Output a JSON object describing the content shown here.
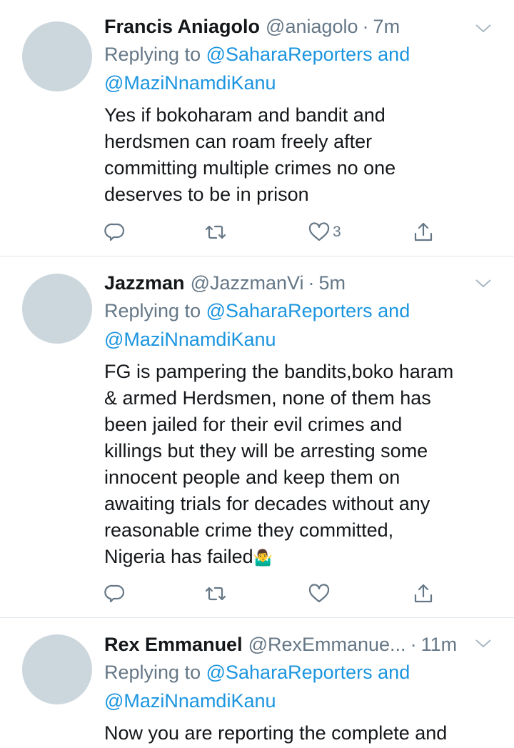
{
  "reply_prefix": "Replying to",
  "tweets": [
    {
      "name": "Francis Aniagolo",
      "handle": "@aniagolo",
      "time": "7m",
      "mention1": "@SaharaReporters",
      "conj": "and",
      "mention2": "@MaziNnamdiKanu",
      "lines": [
        "Yes if bokoharam and bandit and",
        "herdsmen can roam freely after",
        "committing multiple crimes no one",
        "deserves to be in prison"
      ],
      "like_count": "3"
    },
    {
      "name": "Jazzman",
      "handle": "@JazzmanVi",
      "time": "5m",
      "mention1": "@SaharaReporters",
      "conj": "and",
      "mention2": "@MaziNnamdiKanu",
      "lines": [
        "FG is pampering the bandits,boko haram",
        "& armed Herdsmen, none of them has",
        "been jailed for their evil crimes and",
        "killings but they will be arresting some",
        "innocent people and keep them on",
        "awaiting trials for decades without any",
        "reasonable crime they committed,",
        "Nigeria has failed"
      ],
      "emoji": "🤷‍♂️",
      "like_count": ""
    },
    {
      "name": "Rex Emmanuel",
      "handle": "@RexEmmanue...",
      "time": "11m",
      "mention1": "@SaharaReporters",
      "conj": "and",
      "mention2": "@MaziNnamdiKanu",
      "lines": [
        "Now you are reporting the complete and"
      ]
    }
  ],
  "icons": {
    "reply": "reply-icon",
    "retweet": "retweet-icon",
    "like": "heart-icon",
    "share": "share-icon",
    "menu": "chevron-down-icon"
  },
  "colors": {
    "link": "#1b95e0",
    "muted": "#657786",
    "text": "#14171a",
    "avatar": "#ccd6dd",
    "divider": "#e1e8ed"
  }
}
